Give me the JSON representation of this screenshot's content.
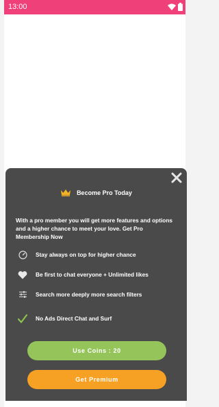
{
  "status_bar": {
    "time": "13:00",
    "icons": [
      "wifi-icon",
      "battery-icon"
    ],
    "color": "#f0407a"
  },
  "pro_sheet": {
    "title": "Become Pro Today",
    "description": "With a pro member you will get more features and options and a higher chance to meet your love. Get Pro Membership Now",
    "features": [
      {
        "icon": "speedometer-icon",
        "text": "Stay always on top for higher chance"
      },
      {
        "icon": "heart-icon",
        "text": "Be first to chat everyone + Unlimited likes"
      },
      {
        "icon": "filter-sliders-icon",
        "text": "Search more deeply more search filters"
      },
      {
        "icon": "checkmark-icon",
        "text": "No Ads Direct Chat and Surf"
      }
    ],
    "use_coins_label": "Use Coins : 20",
    "get_premium_label": "Get Premium",
    "colors": {
      "sheet": "#4a4a4a",
      "coins_button": "#94c45a",
      "premium_button": "#f7a124",
      "crown": "#f5b324",
      "check": "#8bc34a"
    }
  }
}
